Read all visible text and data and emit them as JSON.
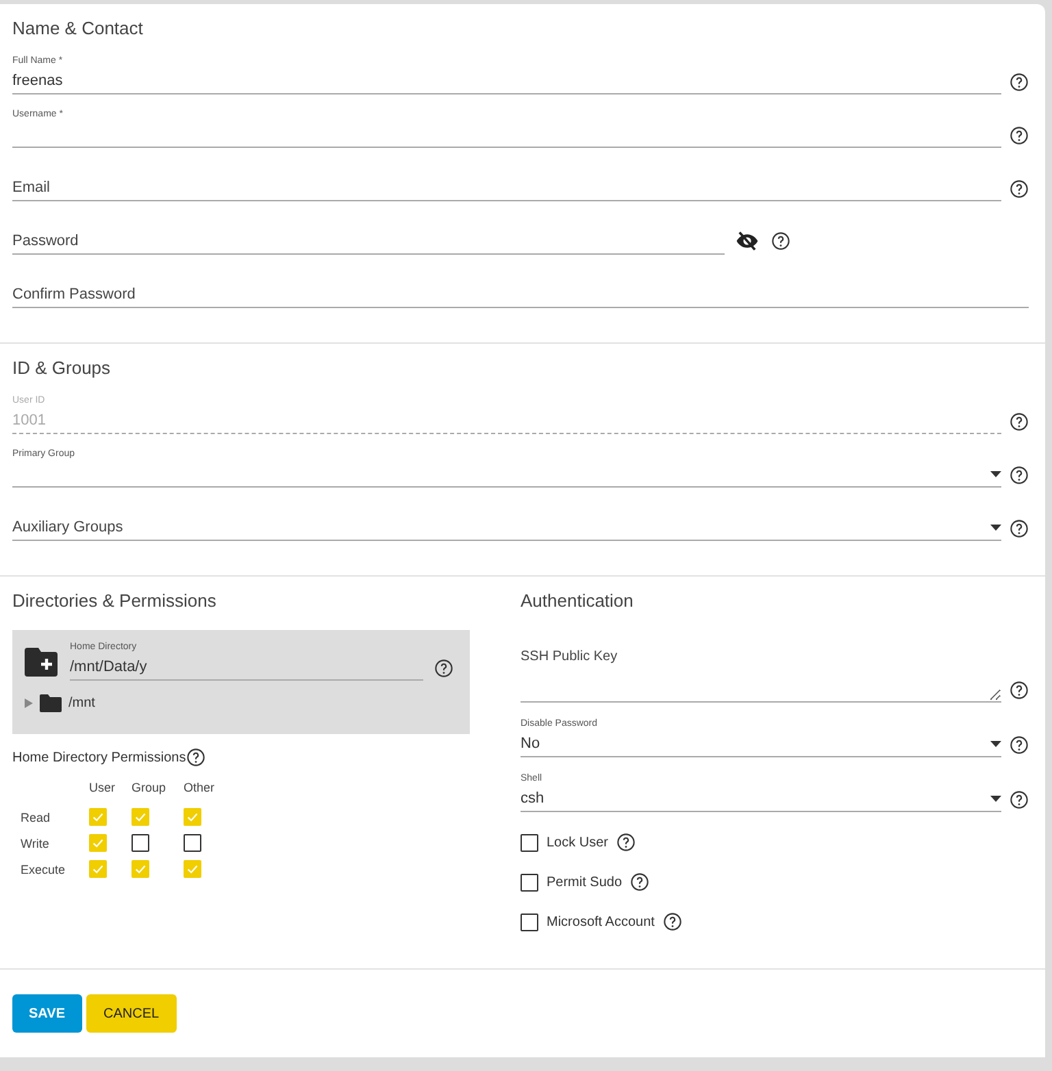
{
  "sections": [
    {
      "title": "Name & Contact",
      "fields": [
        {
          "kind": "text",
          "label": "Full Name *",
          "value": "freenas",
          "help": true,
          "disabled": false
        },
        {
          "kind": "text",
          "label": "Username *",
          "help": true,
          "disabled": false
        },
        {
          "kind": "text",
          "placeholder": "Email",
          "help": true,
          "disabled": false
        },
        {
          "kind": "password",
          "placeholder": "Password",
          "help": true,
          "visible": false,
          "disabled": false
        },
        {
          "kind": "text",
          "placeholder": "Confirm Password",
          "help": false,
          "disabled": false
        }
      ]
    },
    {
      "title": "ID & Groups",
      "fields": [
        {
          "kind": "text",
          "label": "User ID",
          "value": "1001",
          "help": true,
          "disabled": true
        },
        {
          "kind": "select",
          "label": "Primary Group",
          "help": true,
          "disabled": false
        },
        {
          "kind": "select",
          "placeholder": "Auxiliary Groups",
          "help": true,
          "disabled": false
        }
      ]
    }
  ],
  "directories": {
    "title": "Directories & Permissions",
    "home": {
      "label": "Home Directory",
      "value": "/mnt/Data/y",
      "help": true
    },
    "tree": [
      {
        "name": "/mnt",
        "expanded": false
      }
    ],
    "permissions": {
      "label": "Home Directory Permissions",
      "help": true,
      "columns": [
        "User",
        "Group",
        "Other"
      ],
      "rows": [
        {
          "label": "Read",
          "checked": [
            true,
            true,
            true
          ]
        },
        {
          "label": "Write",
          "checked": [
            true,
            false,
            false
          ]
        },
        {
          "label": "Execute",
          "checked": [
            true,
            true,
            true
          ]
        }
      ]
    }
  },
  "authentication": {
    "title": "Authentication",
    "fields": [
      {
        "kind": "textarea",
        "placeholder": "SSH Public Key",
        "help": true,
        "disabled": false
      },
      {
        "kind": "select",
        "label": "Disable Password",
        "value": "No",
        "help": true,
        "disabled": false
      },
      {
        "kind": "select",
        "label": "Shell",
        "value": "csh",
        "help": true,
        "disabled": false
      }
    ],
    "options": [
      {
        "label": "Lock User",
        "checked": false,
        "help": true
      },
      {
        "label": "Permit Sudo",
        "checked": false,
        "help": true
      },
      {
        "label": "Microsoft Account",
        "checked": false,
        "help": true
      }
    ]
  },
  "buttons": [
    {
      "label": "SAVE",
      "kind": "primary"
    },
    {
      "label": "CANCEL",
      "kind": "accent"
    }
  ]
}
